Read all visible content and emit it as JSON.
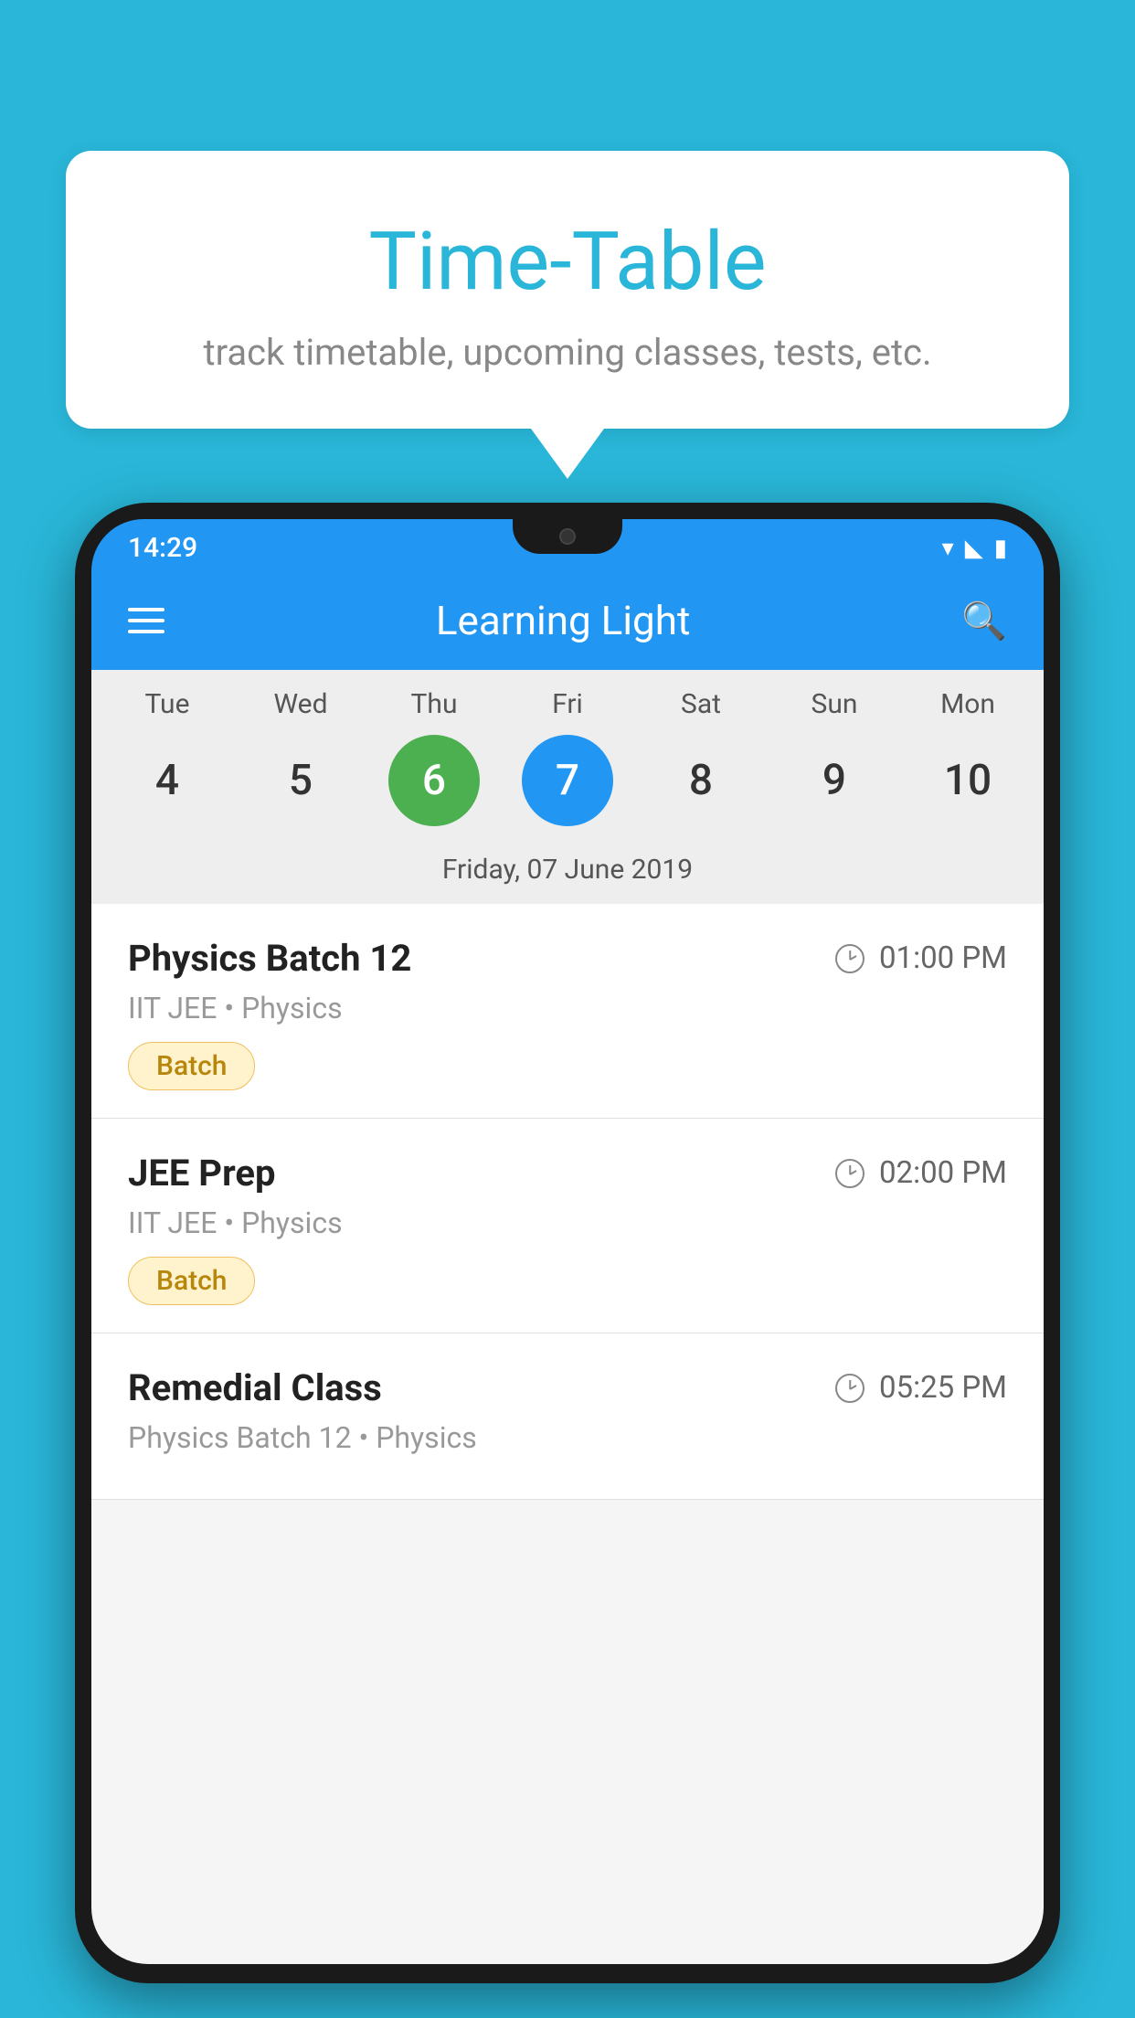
{
  "background_color": "#29b6d8",
  "hero": {
    "title": "Time-Table",
    "subtitle": "track timetable, upcoming classes, tests, etc."
  },
  "app": {
    "toolbar": {
      "title": "Learning Light",
      "menu_icon": "menu",
      "search_icon": "search"
    },
    "status_bar": {
      "time": "14:29"
    },
    "calendar": {
      "days": [
        {
          "label": "Tue",
          "number": "4",
          "state": "normal"
        },
        {
          "label": "Wed",
          "number": "5",
          "state": "normal"
        },
        {
          "label": "Thu",
          "number": "6",
          "state": "today"
        },
        {
          "label": "Fri",
          "number": "7",
          "state": "selected"
        },
        {
          "label": "Sat",
          "number": "8",
          "state": "normal"
        },
        {
          "label": "Sun",
          "number": "9",
          "state": "normal"
        },
        {
          "label": "Mon",
          "number": "10",
          "state": "normal"
        }
      ],
      "selected_date_label": "Friday, 07 June 2019"
    },
    "classes": [
      {
        "name": "Physics Batch 12",
        "time": "01:00 PM",
        "meta": "IIT JEE • Physics",
        "badge": "Batch"
      },
      {
        "name": "JEE Prep",
        "time": "02:00 PM",
        "meta": "IIT JEE • Physics",
        "badge": "Batch"
      },
      {
        "name": "Remedial Class",
        "time": "05:25 PM",
        "meta": "Physics Batch 12 • Physics",
        "badge": null
      }
    ]
  }
}
